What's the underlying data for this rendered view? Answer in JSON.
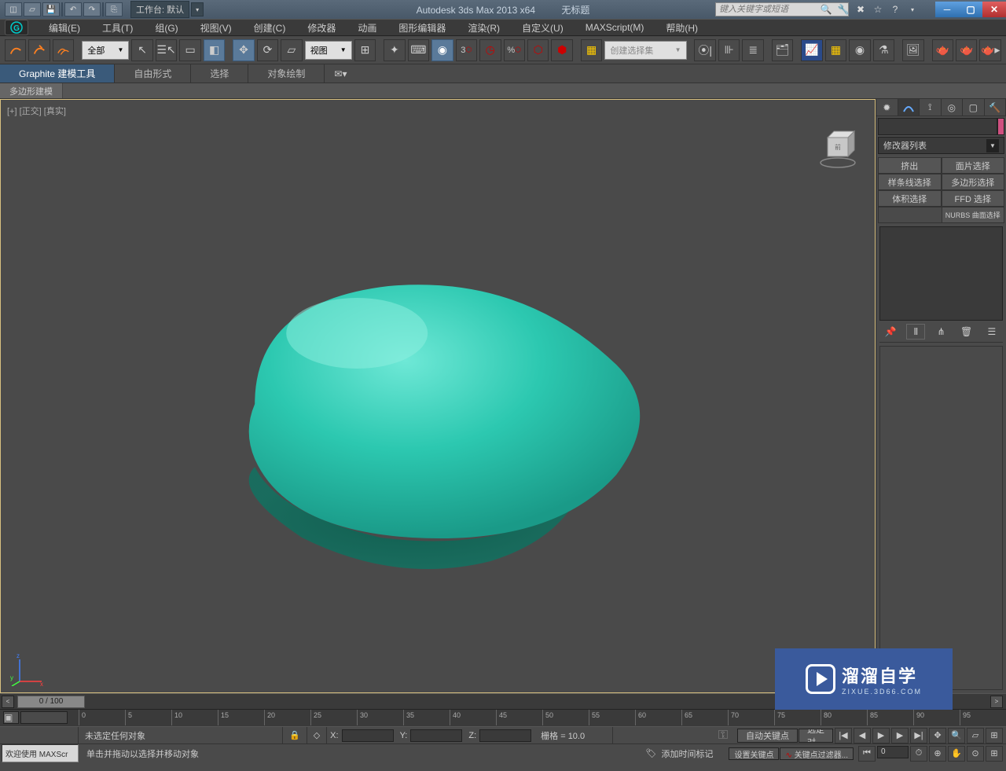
{
  "titlebar": {
    "workspace_label": "工作台: 默认",
    "app_title": "Autodesk 3ds Max  2013 x64",
    "doc_title": "无标题",
    "search_placeholder": "键入关键字或短语"
  },
  "menus": [
    "编辑(E)",
    "工具(T)",
    "组(G)",
    "视图(V)",
    "创建(C)",
    "修改器",
    "动画",
    "图形编辑器",
    "渲染(R)",
    "自定义(U)",
    "MAXScript(M)",
    "帮助(H)"
  ],
  "toolbar": {
    "filter_dropdown": "全部",
    "view_dropdown": "视图",
    "selection_set_dropdown": "创建选择集"
  },
  "ribbon_tabs": [
    "Graphite 建模工具",
    "自由形式",
    "选择",
    "对象绘制"
  ],
  "subribbon": "多边形建模",
  "viewport": {
    "label": "[+] [正交] [真实]"
  },
  "panel": {
    "modifier_list": "修改器列表",
    "buttons": [
      "挤出",
      "面片选择",
      "样条线选择",
      "多边形选择",
      "体积选择",
      "FFD 选择",
      "NURBS 曲面选择"
    ]
  },
  "timeslider": {
    "handle": "0 / 100"
  },
  "trackbar_ticks": [
    "0",
    "5",
    "10",
    "15",
    "20",
    "25",
    "30",
    "35",
    "40",
    "45",
    "50",
    "55",
    "60",
    "65",
    "70",
    "75",
    "80",
    "85",
    "90",
    "95"
  ],
  "status": {
    "selection_text": "未选定任何对象",
    "x_label": "X:",
    "y_label": "Y:",
    "z_label": "Z:",
    "grid_text": "栅格 = 10.0",
    "auto_key": "自动关键点",
    "selected": "选定对",
    "set_key": "设置关键点",
    "key_filter": "关键点过滤器...",
    "frame_field": "0",
    "add_time_tag": "添加时间标记",
    "welcome": "欢迎使用  MAXScr",
    "prompt": "单击并拖动以选择并移动对象"
  },
  "watermark": {
    "big": "溜溜自学",
    "small": "ZIXUE.3D66.COM"
  }
}
